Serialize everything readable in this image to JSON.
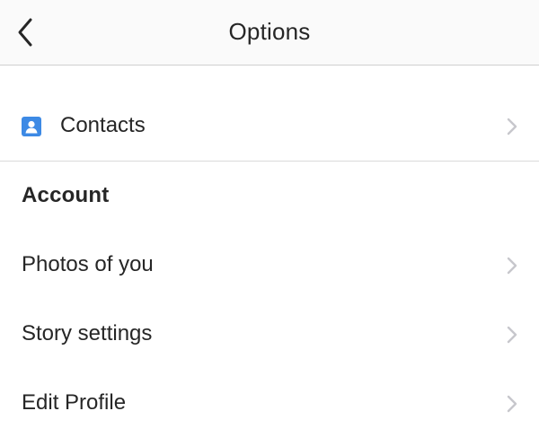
{
  "header": {
    "title": "Options",
    "back_icon": "chevron-left-icon"
  },
  "colors": {
    "header_bg": "#fafafa",
    "text": "#262626",
    "chevron": "#c7c7cc",
    "contacts_icon": "#3d8ae5",
    "divider": "#dbdbdb"
  },
  "contacts": {
    "label": "Contacts",
    "icon": "contact-card-icon"
  },
  "account": {
    "section_title": "Account",
    "items": [
      {
        "label": "Photos of you"
      },
      {
        "label": "Story settings"
      },
      {
        "label": "Edit Profile"
      }
    ]
  }
}
